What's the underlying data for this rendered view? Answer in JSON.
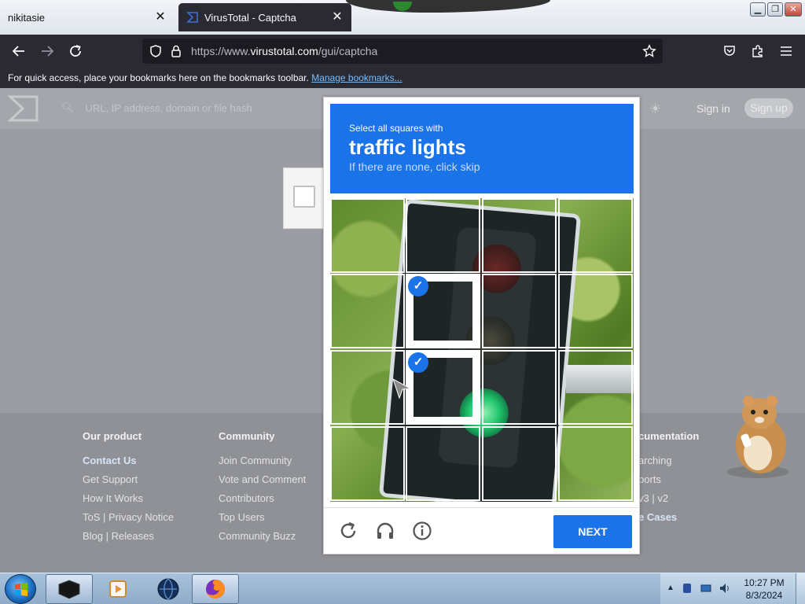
{
  "browser": {
    "tabs": [
      {
        "title": "nikitasie",
        "close": "✕"
      },
      {
        "title": "VirusTotal - Captcha",
        "close": "✕"
      }
    ],
    "url_scheme": "https://www.",
    "url_host": "virustotal.com",
    "url_path": "/gui/captcha",
    "bookmarks_message": "For quick access, place your bookmarks here on the bookmarks toolbar.",
    "bookmarks_link": "Manage bookmarks..."
  },
  "page": {
    "search_placeholder": "URL, IP address, domain or file hash",
    "sign_in": "Sign in",
    "sign_up": "Sign up",
    "footer": {
      "col1": {
        "heading": "Our product",
        "links": [
          "Contact Us",
          "Get Support",
          "How It Works",
          "ToS | Privacy Notice",
          "Blog | Releases"
        ]
      },
      "col2": {
        "heading": "Community",
        "links": [
          "Join Community",
          "Vote and Comment",
          "Contributors",
          "Top Users",
          "Community Buzz"
        ]
      },
      "col3": {
        "heading": "cumentation",
        "links": [
          "arching",
          "ports",
          "v3 | v2",
          "e Cases"
        ]
      }
    }
  },
  "captcha": {
    "instruction": "Select all squares with",
    "target": "traffic lights",
    "hint": "If there are none, click skip",
    "selected_cells": [
      5,
      9
    ],
    "next_label": "NEXT",
    "accent_color": "#1a73e8"
  },
  "taskbar": {
    "time": "10:27 PM",
    "date": "8/3/2024"
  }
}
